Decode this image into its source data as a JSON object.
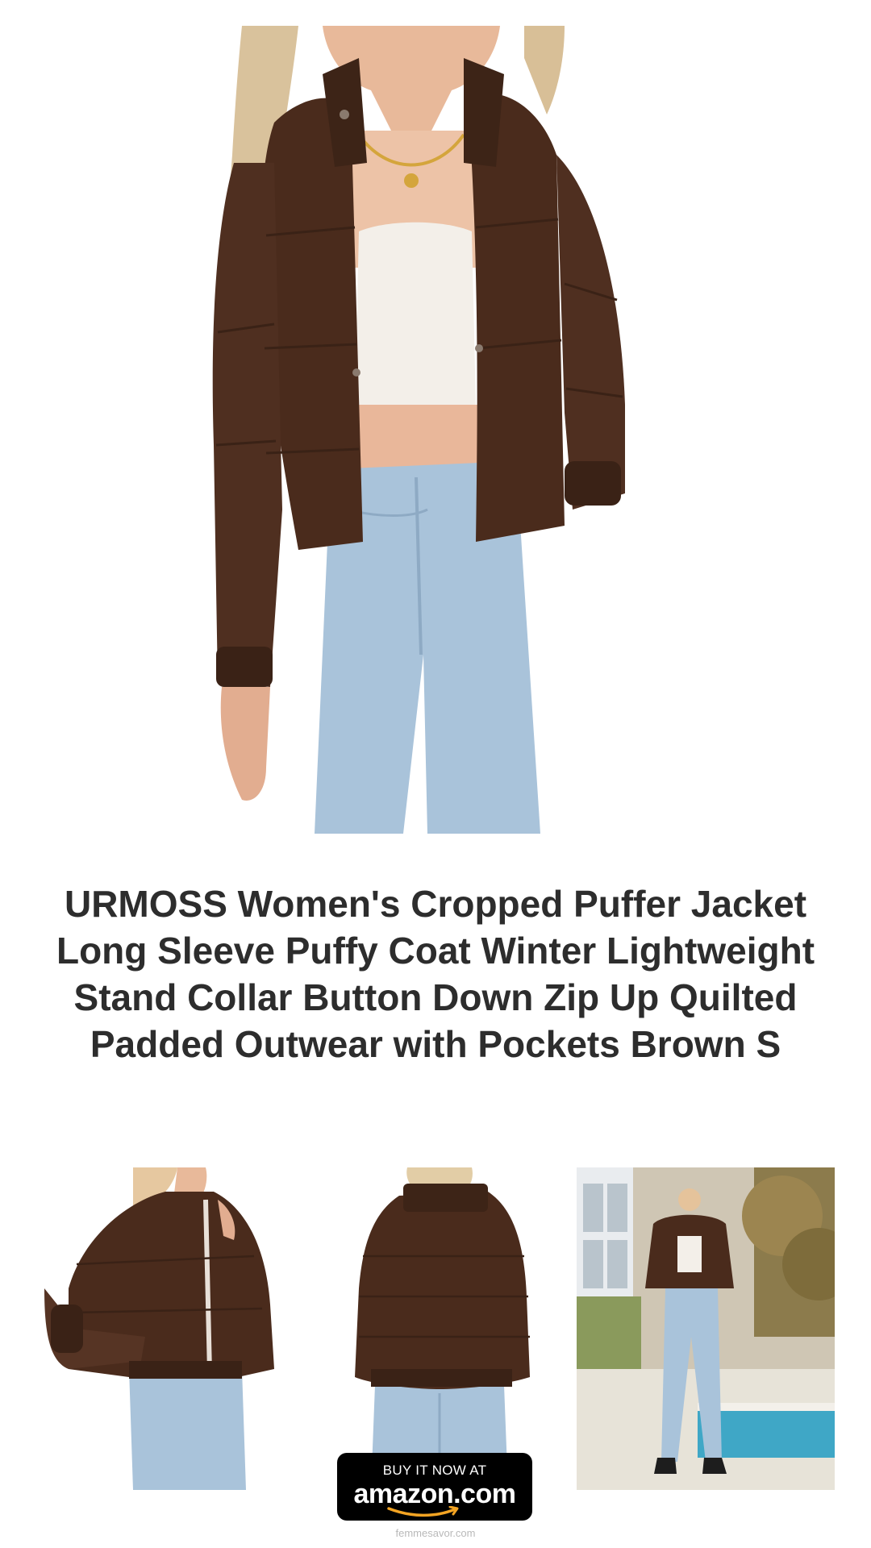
{
  "product": {
    "title": "URMOSS Women's Cropped Puffer Jacket Long Sleeve Puffy Coat Winter Lightweight Stand Collar Button Down Zip Up Quilted Padded Outwear with Pockets Brown S"
  },
  "images": {
    "hero": "product-hero-photo",
    "thumbnails": [
      "front-view-photo",
      "back-view-photo",
      "outdoor-lifestyle-photo"
    ]
  },
  "cta": {
    "top_label": "BUY IT NOW AT",
    "logo_text": "amazon.com"
  },
  "footer": {
    "site": "femmesavor.com"
  },
  "colors": {
    "jacket": "#4a2b1c",
    "denim": "#a9c3da",
    "button_bg": "#000000",
    "smile": "#f3a423"
  }
}
